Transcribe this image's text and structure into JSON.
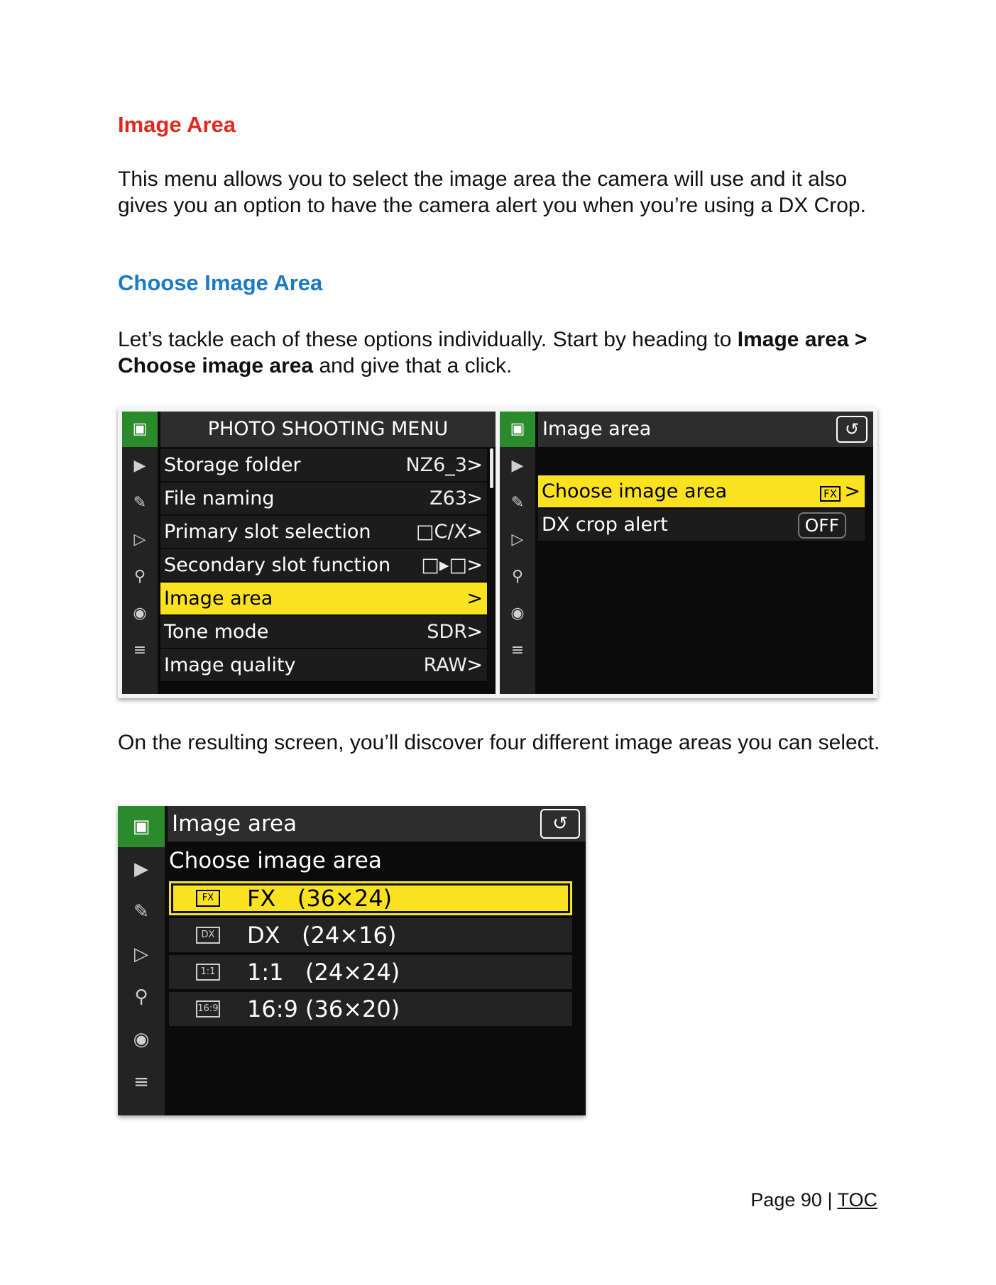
{
  "heading": "Image Area",
  "intro": "This menu allows you to select the image area the camera will use and it also gives you an option to have the camera alert you when you’re using a DX Crop.",
  "subheading": "Choose Image Area",
  "para2": {
    "prefix": "Let’s tackle each of these options individually. Start by heading to ",
    "bold": "Image area > Choose image area",
    "suffix": " and give that a click."
  },
  "para3": "On the resulting screen, you’ll discover four different image areas you can select.",
  "screen_a": {
    "title": "PHOTO SHOOTING MENU",
    "items": [
      {
        "label": "Storage folder",
        "value": "NZ6_3"
      },
      {
        "label": "File naming",
        "value": "Z63"
      },
      {
        "label": "Primary slot selection",
        "value": "□C/X"
      },
      {
        "label": "Secondary slot function",
        "value": "□▸□"
      },
      {
        "label": "Image area",
        "value": ""
      },
      {
        "label": "Tone mode",
        "value": "SDR"
      },
      {
        "label": "Image quality",
        "value": "RAW"
      }
    ],
    "chevron": ">"
  },
  "screen_b": {
    "title": "Image area",
    "items": [
      {
        "label": "Choose image area",
        "value": "FX"
      },
      {
        "label": "DX crop alert",
        "value": "OFF"
      }
    ],
    "chevron": ">"
  },
  "screen_c": {
    "title": "Image area",
    "subtitle": "Choose image area",
    "options": [
      {
        "icon": "FX",
        "label": "FX   (36×24)"
      },
      {
        "icon": "DX",
        "label": "DX   (24×16)"
      },
      {
        "icon": "1:1",
        "label": "1:1   (24×24)"
      },
      {
        "icon": "16:9",
        "label": "16:9 (36×20)"
      }
    ]
  },
  "sidebar_icons": [
    "camera-icon",
    "movie-icon",
    "pencil-icon",
    "playback-icon",
    "wrench-icon",
    "network-icon",
    "my-menu-icon"
  ],
  "back_symbol": "↺",
  "footer": {
    "page": "Page 90 | ",
    "toc": "TOC"
  },
  "colors": {
    "heading": "#e0281c",
    "subheading": "#1a7ac2",
    "highlight": "#fbe221",
    "active_tab": "#2b8a2b"
  }
}
